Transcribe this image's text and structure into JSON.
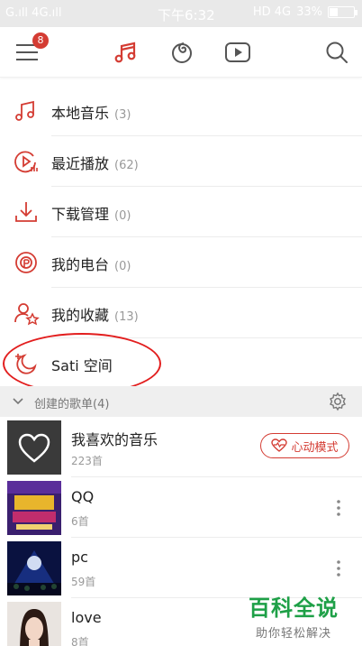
{
  "status_bar": {
    "left": "G.ıll 4G.ıll",
    "time": "下午6:32",
    "network": "HD 4G",
    "battery": "33%",
    "battery_level": 0.33
  },
  "toolbar": {
    "badge_count": "8",
    "accent_color": "#d43c33"
  },
  "menu": [
    {
      "label": "本地音乐",
      "count": "(3)",
      "icon": "music-note-icon"
    },
    {
      "label": "最近播放",
      "count": "(62)",
      "icon": "recent-play-icon"
    },
    {
      "label": "下载管理",
      "count": "(0)",
      "icon": "download-icon"
    },
    {
      "label": "我的电台",
      "count": "(0)",
      "icon": "radio-station-icon"
    },
    {
      "label": "我的收藏",
      "count": "(13)",
      "icon": "collection-icon"
    },
    {
      "label": "Sati 空间",
      "count": "",
      "icon": "sati-moon-icon"
    }
  ],
  "section": {
    "title": "创建的歌单(4)"
  },
  "playlists": [
    {
      "name": "我喜欢的音乐",
      "sub": "223首",
      "action": "心动模式"
    },
    {
      "name": "QQ",
      "sub": "6首"
    },
    {
      "name": "pc",
      "sub": "59首"
    },
    {
      "name": "love",
      "sub": "8首"
    }
  ],
  "watermark": {
    "title": "百科全说",
    "subtitle": "助你轻松解决"
  }
}
